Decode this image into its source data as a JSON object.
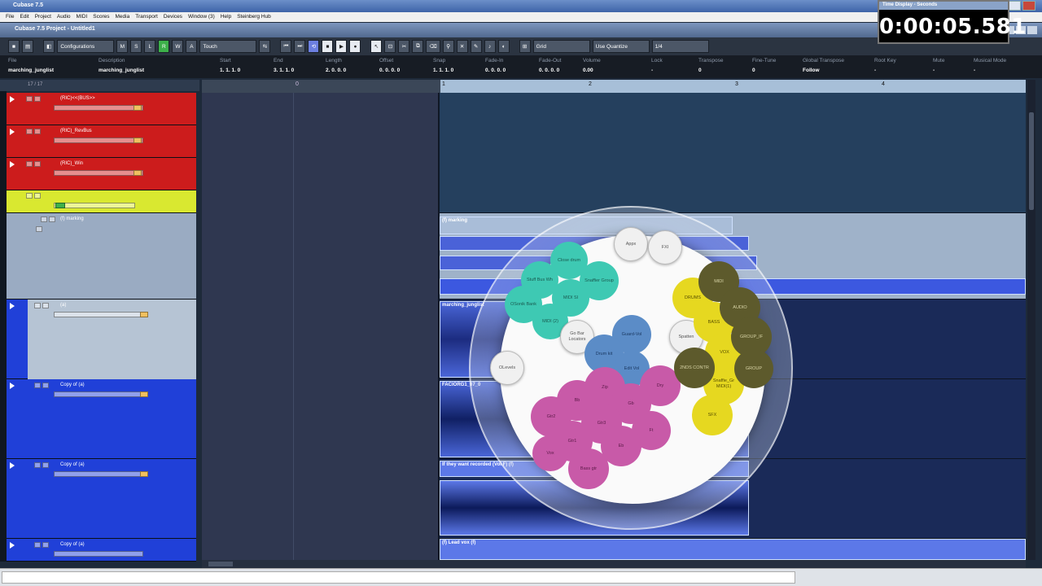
{
  "os": {
    "title": "Cubase 7.5",
    "menu": [
      "File",
      "Edit",
      "Project",
      "Audio",
      "MIDI",
      "Scores",
      "Media",
      "Transport",
      "Devices",
      "Window (3)",
      "Help",
      "Steinberg Hub"
    ]
  },
  "time_display": {
    "title": "Time Display - Seconds",
    "value": "0:00:05.581"
  },
  "project_window": {
    "title": "Cubase 7.5 Project - Untitled1"
  },
  "toolbar": {
    "configurations": "Configurations",
    "automation_mode": "Touch",
    "quantize": "Use Quantize",
    "grid": "1/4",
    "m": "M",
    "s": "S",
    "l": "L",
    "r": "R",
    "w": "W",
    "a": "A"
  },
  "infoline": {
    "columns": [
      {
        "h": "File",
        "v": "marching_junglist"
      },
      {
        "h": "Description",
        "v": "marching_junglist"
      },
      {
        "h": "Start",
        "v": "1. 1. 1. 0"
      },
      {
        "h": "End",
        "v": "3. 1. 1. 0"
      },
      {
        "h": "Length",
        "v": "2. 0. 0. 0"
      },
      {
        "h": "Offset",
        "v": "0. 0. 0. 0"
      },
      {
        "h": "Snap",
        "v": "1. 1. 1. 0"
      },
      {
        "h": "Fade-In",
        "v": "0. 0. 0. 0"
      },
      {
        "h": "Fade-Out",
        "v": "0. 0. 0. 0"
      },
      {
        "h": "Volume",
        "v": "0.00"
      },
      {
        "h": "Lock",
        "v": "-"
      },
      {
        "h": "Transpose",
        "v": "0"
      },
      {
        "h": "Fine-Tune",
        "v": "0"
      },
      {
        "h": "Global Transpose",
        "v": "Follow"
      },
      {
        "h": "Root Key",
        "v": "-"
      },
      {
        "h": "Mute",
        "v": "-"
      },
      {
        "h": "Musical Mode",
        "v": "-"
      }
    ]
  },
  "tracklist": {
    "header": "17 / 17",
    "tracks": [
      {
        "name": "(RIC)<<(BUS>>",
        "color": "#cc1c1c"
      },
      {
        "name": "(RIC)_RevBus",
        "color": "#cc1c1c"
      },
      {
        "name": "(RIC)_Win",
        "color": "#cc1c1c"
      },
      {
        "name": "",
        "color": "#d9e830"
      },
      {
        "name": "(f) marking",
        "color": "#9aabc2"
      },
      {
        "name": "(a)",
        "color": "#b6c4d4"
      },
      {
        "name": "Copy of (a)",
        "color": "#2040d8"
      },
      {
        "name": "Copy of (a)",
        "color": "#2040d8"
      },
      {
        "name": "Copy of (a)",
        "color": "#2040d8"
      }
    ]
  },
  "ruler": {
    "bars": [
      "0",
      "1",
      "2",
      "3",
      "4"
    ]
  },
  "events": {
    "marking": "(f) marking",
    "marching": "marching_junglist",
    "vocal": "FACIORG1_07_0",
    "chorus": "If they want recorded (Vol F) (f)",
    "lead": "(f) Lead vox (f)"
  },
  "quick_controls": {
    "teal_nodes": [
      "Close drum",
      "Stuff Bus Wh",
      "Snaffier Group",
      "MIDI SI",
      "OSonik Bank",
      "MIDI (2)"
    ],
    "white_nodes": [
      "Appx",
      "FXI",
      "Go Bar Locators",
      "Spatten",
      "OLevels"
    ],
    "blue_nodes": [
      "Guard-Vol",
      "Drum kit",
      "Edit Vol"
    ],
    "pink_nodes": [
      "Zip",
      "Dry",
      "Bb",
      "Gb",
      "Gtr2",
      "Gtr3",
      "Ft",
      "Gtr1",
      "Eb",
      "Bass gtr",
      "Vox"
    ],
    "yellow_nodes": [
      "DRUMS",
      "BASS",
      "VOX",
      "SFX",
      "Snaffie_Gr MIDI(1)"
    ],
    "olive_nodes": [
      "MIDI",
      "AUDIO",
      "GROUP_IF",
      "GROUP",
      "2NDS CONTR"
    ]
  }
}
